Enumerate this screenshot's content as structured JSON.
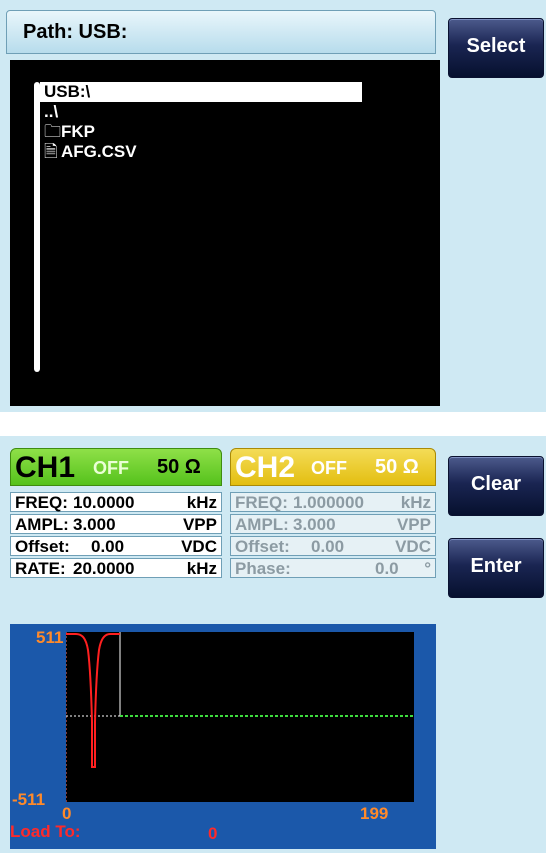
{
  "file_browser": {
    "path_label": "Path: USB:",
    "items": [
      {
        "name": "USB:\\",
        "icon": "",
        "selected": true
      },
      {
        "name": "..\\",
        "icon": "",
        "selected": false
      },
      {
        "name": "FKP",
        "icon": "folder-icon",
        "selected": false
      },
      {
        "name": "AFG.CSV",
        "icon": "file-icon",
        "selected": false
      }
    ]
  },
  "softkeys": {
    "select": "Select",
    "clear": "Clear",
    "enter": "Enter"
  },
  "channels": {
    "ch1": {
      "name": "CH1",
      "state": "OFF",
      "impedance": "50 Ω",
      "color": "#55c21c",
      "rows": [
        {
          "label": "FREQ:",
          "value": "10.0000",
          "unit": "kHz"
        },
        {
          "label": "AMPL:",
          "value": "3.000",
          "unit": "VPP"
        },
        {
          "label": "Offset:",
          "value": "0.00",
          "unit": "VDC"
        },
        {
          "label": "RATE:",
          "value": "20.0000",
          "unit": "kHz"
        }
      ]
    },
    "ch2": {
      "name": "CH2",
      "state": "OFF",
      "impedance": "50 Ω",
      "color": "#e3be10",
      "rows": [
        {
          "label": "FREQ:",
          "value": "1.000000",
          "unit": "kHz"
        },
        {
          "label": "AMPL:",
          "value": "3.000",
          "unit": "VPP"
        },
        {
          "label": "Offset:",
          "value": "0.00",
          "unit": "VDC"
        },
        {
          "label": "Phase:",
          "value": "0.0",
          "unit": "°"
        }
      ]
    }
  },
  "waveform": {
    "y_max": "511",
    "y_min": "-511",
    "x_min": "0",
    "x_max": "199",
    "load_label": "Load To:",
    "load_value": "0",
    "trace_color": "#ff2020",
    "baseline_color": "#3ddc3d"
  }
}
